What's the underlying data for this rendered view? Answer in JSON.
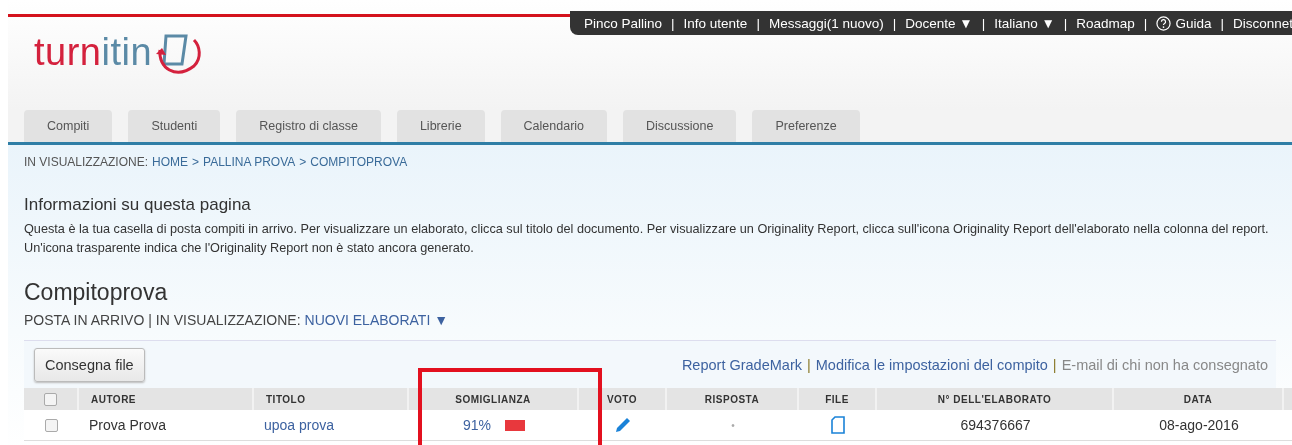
{
  "top_bar": {
    "separator": "|",
    "items": [
      {
        "label": "Pinco Pallino",
        "kind": "text"
      },
      {
        "label": "Info utente",
        "kind": "text"
      },
      {
        "label": "Messaggi(1 nuovo)",
        "kind": "text"
      },
      {
        "label": "Docente ▼",
        "kind": "text"
      },
      {
        "label": "Italiano ▼",
        "kind": "text"
      },
      {
        "label": "Roadmap",
        "kind": "text"
      },
      {
        "label": "Guida",
        "kind": "help"
      },
      {
        "label": "Disconnet",
        "kind": "text"
      }
    ]
  },
  "logo": {
    "part1": "turn",
    "part2": "itin"
  },
  "tabs": [
    {
      "label": "Compiti"
    },
    {
      "label": "Studenti"
    },
    {
      "label": "Registro di classe"
    },
    {
      "label": "Librerie"
    },
    {
      "label": "Calendario"
    },
    {
      "label": "Discussione"
    },
    {
      "label": "Preferenze"
    }
  ],
  "breadcrumb": {
    "label": "IN VISUALIZZAZIONE:",
    "separator": ">",
    "links": [
      "HOME",
      "PALLINA PROVA",
      "COMPITOPROVA"
    ]
  },
  "info": {
    "title": "Informazioni su questa pagina",
    "text": "Questa è la tua casella di posta compiti in arrivo. Per visualizzare un elaborato, clicca sul titolo del documento. Per visualizzare un Originality Report, clicca sull'icona Originality Report dell'elaborato nella colonna del report. Un'icona trasparente indica che l'Originality Report non è stato ancora generato."
  },
  "assignment": {
    "title": "Compitoprova",
    "inbox": "POSTA IN ARRIVO",
    "view_label": "| IN VISUALIZZAZIONE:",
    "view_value": "NUOVI ELABORATI ▼"
  },
  "toolbar": {
    "button": "Consegna file",
    "separator": "|",
    "links": [
      {
        "label": "Report GradeMark",
        "disabled": false
      },
      {
        "label": "Modifica le impostazioni del compito",
        "disabled": false
      },
      {
        "label": "E-mail di chi non ha consegnato",
        "disabled": true
      }
    ]
  },
  "table": {
    "columns": [
      "AUTORE",
      "TITOLO",
      "SOMIGLIANZA",
      "VOTO",
      "RISPOSTA",
      "FILE",
      "N° DELL'ELABORATO",
      "DATA"
    ],
    "rows": [
      {
        "checked": false,
        "author": "Prova Prova",
        "title": "upoa prova",
        "similarity": "91%",
        "color": "#e8383d",
        "response": "•",
        "paper_id": "694376667",
        "date": "08-ago-2016"
      }
    ],
    "header_checked": false
  },
  "highlight": {
    "kind": "box"
  }
}
